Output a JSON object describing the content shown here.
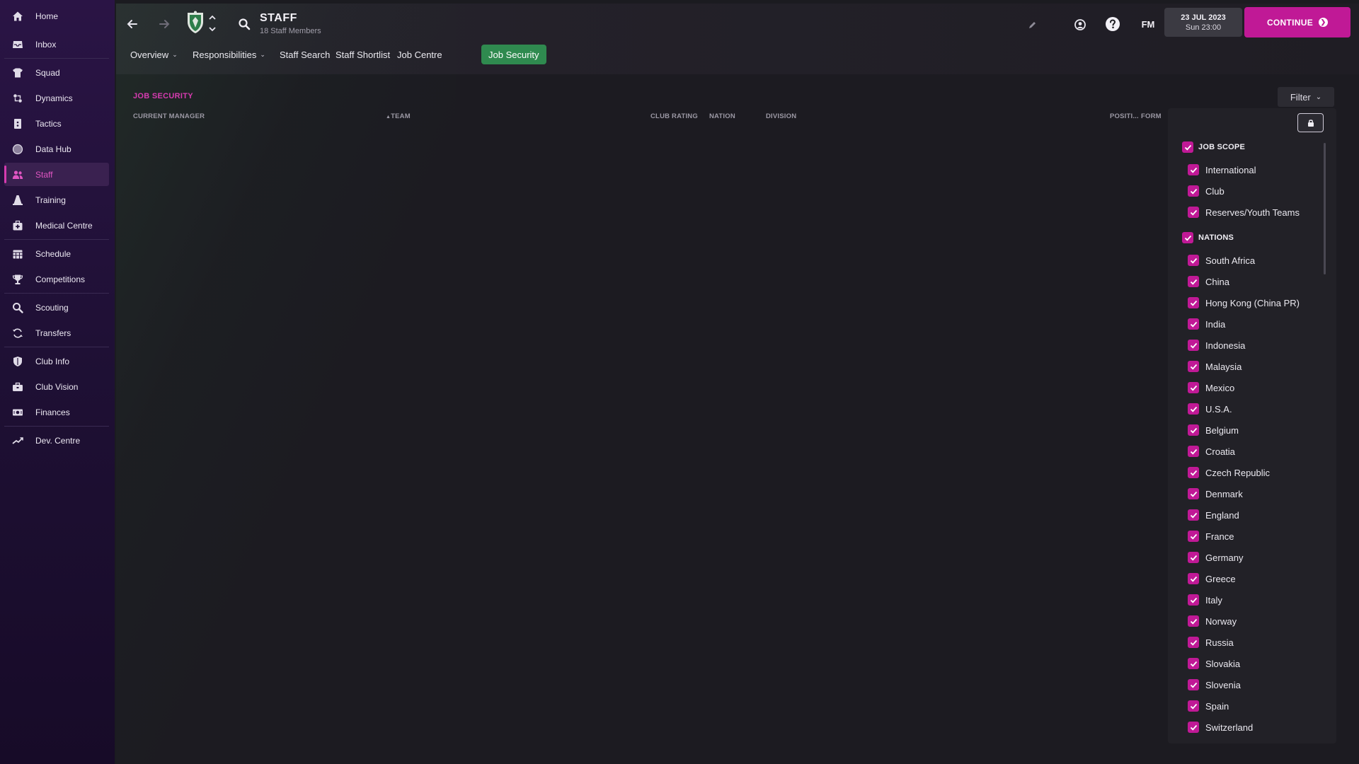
{
  "sidebar": {
    "items": [
      {
        "label": "Home",
        "icon": "home-icon"
      },
      {
        "label": "Inbox",
        "icon": "inbox-icon"
      },
      {
        "label": "Squad",
        "icon": "shirt-icon"
      },
      {
        "label": "Dynamics",
        "icon": "dynamics-icon"
      },
      {
        "label": "Tactics",
        "icon": "tactics-board-icon"
      },
      {
        "label": "Data Hub",
        "icon": "data-hub-icon"
      },
      {
        "label": "Staff",
        "icon": "staff-icon"
      },
      {
        "label": "Training",
        "icon": "training-cone-icon"
      },
      {
        "label": "Medical Centre",
        "icon": "medical-icon"
      },
      {
        "label": "Schedule",
        "icon": "calendar-icon"
      },
      {
        "label": "Competitions",
        "icon": "trophy-icon"
      },
      {
        "label": "Scouting",
        "icon": "search-icon"
      },
      {
        "label": "Transfers",
        "icon": "transfers-icon"
      },
      {
        "label": "Club Info",
        "icon": "shield-icon"
      },
      {
        "label": "Club Vision",
        "icon": "briefcase-icon"
      },
      {
        "label": "Finances",
        "icon": "money-icon"
      },
      {
        "label": "Dev. Centre",
        "icon": "development-icon"
      }
    ],
    "active": "Staff"
  },
  "header": {
    "title": "STAFF",
    "subtitle": "18 Staff Members",
    "date": "23 JUL 2023",
    "time": "Sun 23:00",
    "fm_label": "FM",
    "continue_label": "CONTINUE"
  },
  "tabs": [
    {
      "label": "Overview",
      "dropdown": true
    },
    {
      "label": "Responsibilities",
      "dropdown": true
    },
    {
      "label": "Staff Search",
      "dropdown": false
    },
    {
      "label": "Staff Shortlist",
      "dropdown": false
    },
    {
      "label": "Job Centre",
      "dropdown": false
    },
    {
      "label": "Job Security",
      "dropdown": false,
      "active": true
    }
  ],
  "content": {
    "section_title": "JOB SECURITY",
    "columns": [
      "CURRENT MANAGER",
      "TEAM",
      "CLUB RATING",
      "NATION",
      "DIVISION",
      "POSITI...",
      "FORM"
    ],
    "sorted_column": "TEAM",
    "filter_label": "Filter"
  },
  "filter": {
    "job_scope": {
      "label": "JOB SCOPE",
      "checked": true,
      "items": [
        "International",
        "Club",
        "Reserves/Youth Teams"
      ]
    },
    "nations": {
      "label": "NATIONS",
      "checked": true,
      "items": [
        "South Africa",
        "China",
        "Hong Kong (China PR)",
        "India",
        "Indonesia",
        "Malaysia",
        "Mexico",
        "U.S.A.",
        "Belgium",
        "Croatia",
        "Czech Republic",
        "Denmark",
        "England",
        "France",
        "Germany",
        "Greece",
        "Italy",
        "Norway",
        "Russia",
        "Slovakia",
        "Slovenia",
        "Spain",
        "Switzerland"
      ]
    }
  },
  "colors": {
    "accent": "#c01996",
    "active_tab": "#2f8a4f",
    "sidebar": "#22113a",
    "background": "#1c1b21"
  }
}
